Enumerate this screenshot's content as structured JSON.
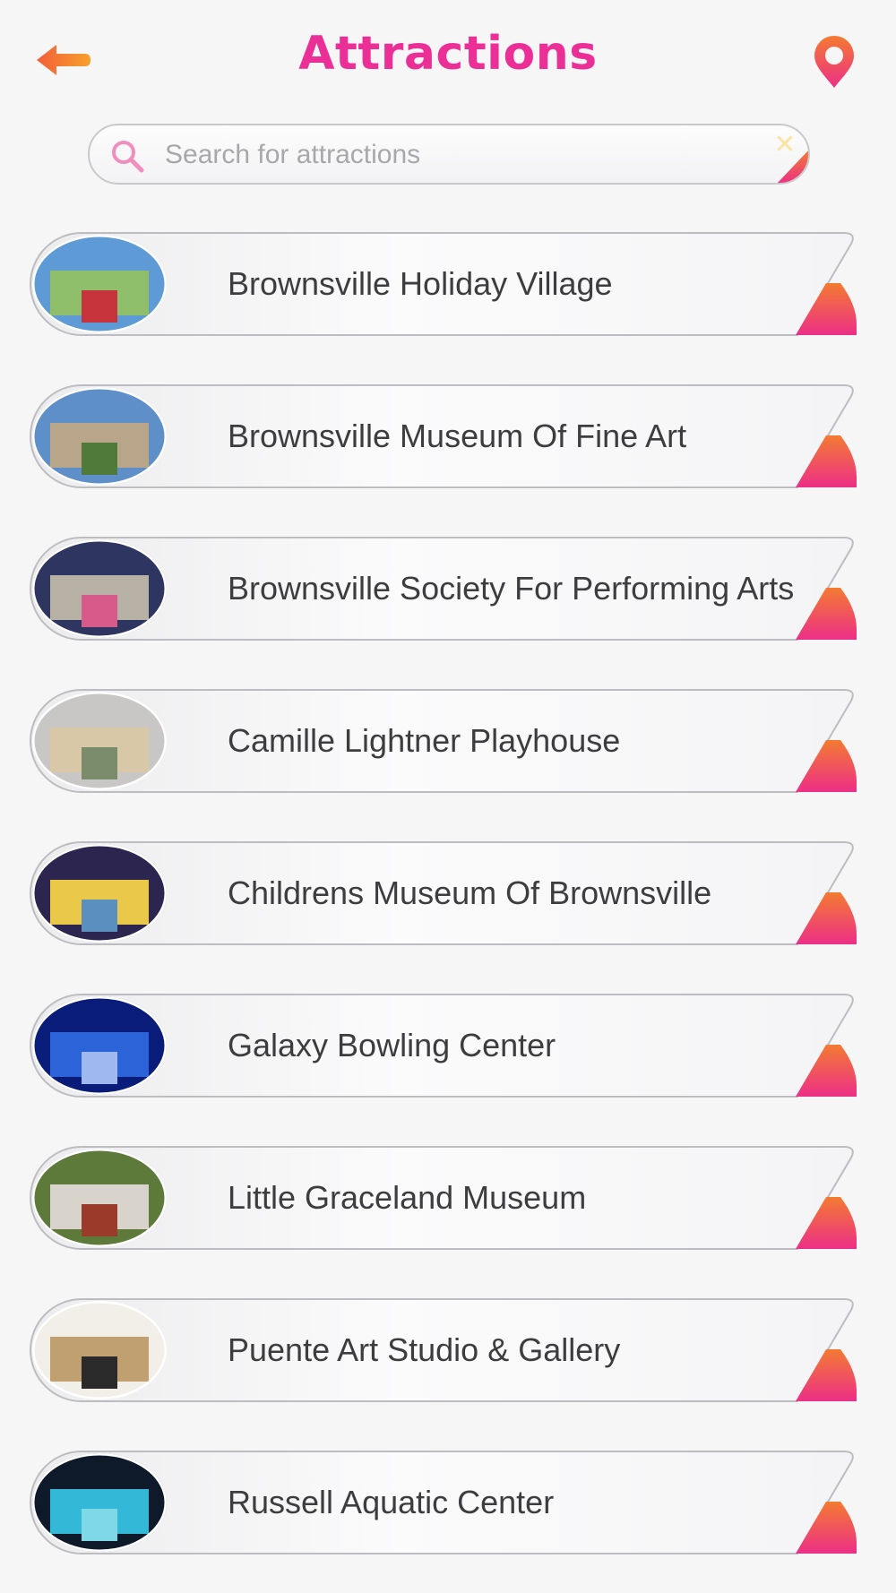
{
  "header": {
    "title": "Attractions",
    "back_icon": "arrow-left-icon",
    "map_icon": "map-pin-icon"
  },
  "search": {
    "placeholder": "Search for attractions",
    "value": ""
  },
  "colors": {
    "accent": "#ec2f97",
    "back_arrow_start": "#f25e3a",
    "back_arrow_end": "#f7a02a",
    "pin_top": "#f47b32",
    "pin_bottom": "#ec2f86"
  },
  "attractions": [
    {
      "label": "Brownsville Holiday Village"
    },
    {
      "label": "Brownsville Museum Of Fine Art"
    },
    {
      "label": "Brownsville Society For Performing Arts"
    },
    {
      "label": "Camille Lightner Playhouse"
    },
    {
      "label": "Childrens Museum Of Brownsville"
    },
    {
      "label": "Galaxy Bowling Center"
    },
    {
      "label": "Little Graceland Museum"
    },
    {
      "label": "Puente Art Studio & Gallery"
    },
    {
      "label": "Russell Aquatic Center"
    }
  ]
}
